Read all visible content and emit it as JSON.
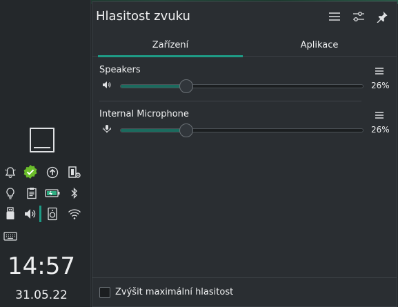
{
  "popup": {
    "title": "Hlasitost zvuku",
    "tabs": [
      {
        "label": "Zařízení",
        "active": true
      },
      {
        "label": "Aplikace",
        "active": false
      }
    ],
    "devices": [
      {
        "name": "Speakers",
        "icon": "speaker-icon",
        "volume_label": "26%",
        "volume": 0.26
      },
      {
        "name": "Internal Microphone",
        "icon": "microphone-icon",
        "volume_label": "26%",
        "volume": 0.26
      }
    ],
    "footer": {
      "checkbox_label": "Zvýšit maximální hlasitost",
      "checked": false
    }
  },
  "clock": {
    "time": "14:57",
    "date": "31.05.22"
  },
  "tray": [
    "notifications-icon",
    "vault-check-icon",
    "updates-icon",
    "clipboard-settings-icon",
    "night-color-icon",
    "clipboard-icon",
    "battery-icon",
    "bluetooth-icon",
    "usb-device-icon",
    "audio-volume-icon",
    "media-player-icon",
    "wifi-icon",
    "keyboard-icon"
  ],
  "colors": {
    "accent": "#1e9c86",
    "panel": "#24282b",
    "popup": "#2a2e32"
  }
}
